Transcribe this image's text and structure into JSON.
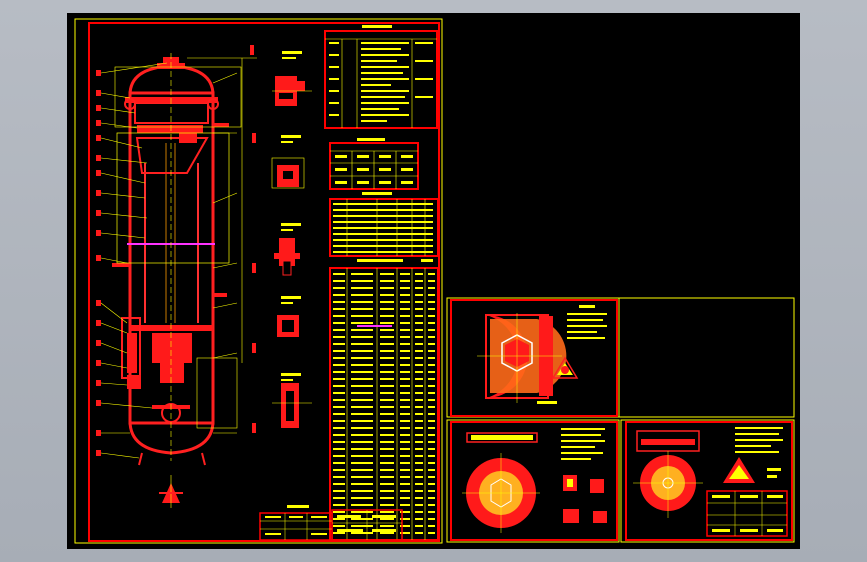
{
  "app": {
    "title": ""
  },
  "sheets": {
    "main": {
      "title_block": {
        "text": ""
      },
      "tables": [
        {
          "caption": ""
        },
        {
          "caption": ""
        },
        {
          "caption": ""
        },
        {
          "caption": ""
        }
      ]
    },
    "detail_1": {
      "note": ""
    },
    "detail_2": {
      "note": ""
    },
    "detail_3": {
      "note": ""
    }
  },
  "colors": {
    "border": "#ff0000",
    "frame": "#ffff00",
    "text": "#ffff00",
    "fill": "#ff1a1a",
    "highlight": "#ff33ff",
    "background": "#000000",
    "chrome": "#b0b5bd"
  }
}
